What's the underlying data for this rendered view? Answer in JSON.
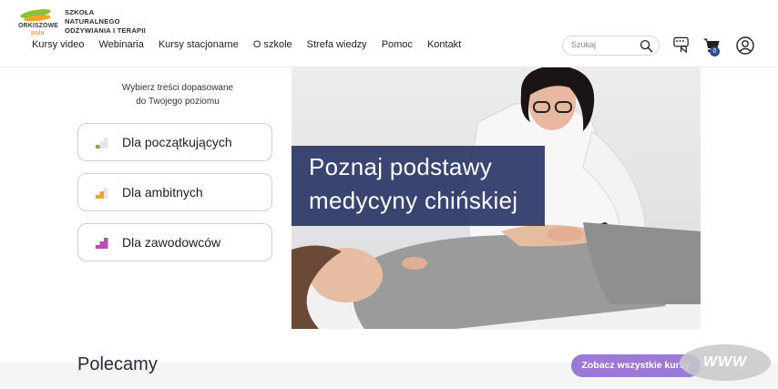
{
  "header": {
    "brand_line1": "ORKISZOWE",
    "brand_line2": "pola",
    "school_name_lines": [
      "SZKOŁA",
      "NATURALNEGO",
      "ODŻYWIANIA I TERAPII"
    ],
    "nav": [
      "Kursy video",
      "Webinaria",
      "Kursy stacjonarne",
      "O szkole",
      "Strefa wiedzy",
      "Pomoc",
      "Kontakt"
    ],
    "search_placeholder": "Szukaj",
    "cart_count": "0",
    "icons": [
      "search-icon",
      "support-chat-icon",
      "cart-icon",
      "user-account-icon"
    ]
  },
  "levels": {
    "lead_line1": "Wybierz treści dopasowane",
    "lead_line2": "do Twojego poziomu",
    "items": [
      {
        "label": "Dla początkujących",
        "color": "#7cb342"
      },
      {
        "label": "Dla ambitnych",
        "color": "#f0a323"
      },
      {
        "label": "Dla zawodowców",
        "color": "#b94fb2"
      }
    ]
  },
  "hero": {
    "title_line1": "Poznaj podstawy",
    "title_line2": "medycyny chińskiej",
    "caption_color": "#2c3867"
  },
  "recommended": {
    "title": "Polecamy",
    "see_all": "Zobacz wszystkie kursy",
    "accent": "#9c79d6"
  },
  "watermark": "WWW"
}
